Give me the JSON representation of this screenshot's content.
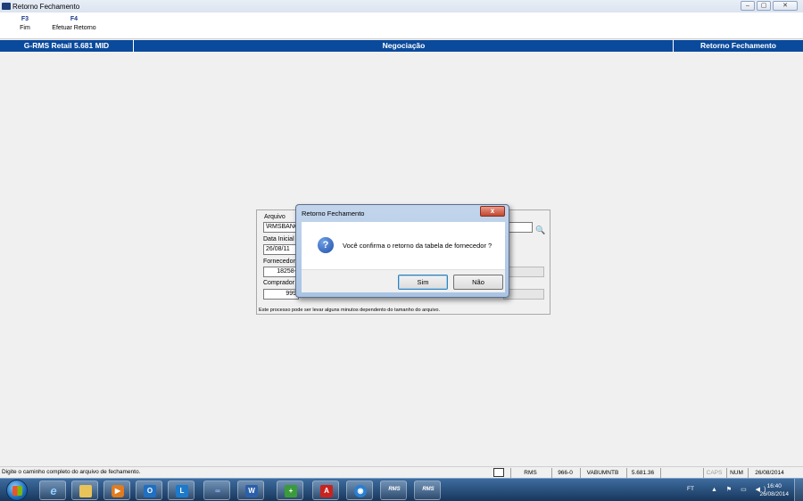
{
  "window": {
    "title": "Retorno Fechamento",
    "controls": [
      "minimize",
      "maximize",
      "close"
    ]
  },
  "function_keys": [
    {
      "key": "F3",
      "label": "Fim"
    },
    {
      "key": "F4",
      "label": "Efetuar Retorno"
    }
  ],
  "header_band": {
    "system": "G-RMS Retail 5.681 MID",
    "module": "Negociação",
    "screen": "Retorno Fechamento"
  },
  "form": {
    "arquivo_label": "Arquivo",
    "arquivo_value": "\\RMSBANC",
    "data_inicial_label": "Data Inicial",
    "data_inicial_value": "26/08/11",
    "fornecedor_label": "Fornecedor",
    "fornecedor_value": "18258-",
    "comprador_label": "Comprador",
    "comprador_value": "999",
    "note": "Este processo pode ser levar alguns minutos dependento do tamanho do arquivo.",
    "browse_icon": "binoculars-icon"
  },
  "dialog": {
    "title": "Retorno Fechamento",
    "close_glyph": "x",
    "icon": "question-icon",
    "message": "Você confirma o retorno da tabela de fornecedor ?",
    "yes_label": "Sim",
    "no_label": "Não"
  },
  "status_bar": {
    "hint": "Digite o caminho completo do arquivo de fechamento.",
    "cells": [
      "RMS",
      "966-0",
      "VABUMNTB",
      "5.681.36",
      "",
      "CAPS",
      "NUM",
      "26/08/2014"
    ]
  },
  "taskbar": {
    "apps": [
      "internet-explorer-icon",
      "file-explorer-icon",
      "media-player-icon",
      "outlook-icon",
      "lync-icon",
      "app-icon",
      "word-icon",
      "database-icon",
      "acrobat-icon",
      "app-icon",
      "rms-app",
      "rms-app"
    ],
    "rms_label": "RMS",
    "tray_lang": "FT",
    "clock_time": "16:40",
    "clock_date": "26/08/2014"
  }
}
